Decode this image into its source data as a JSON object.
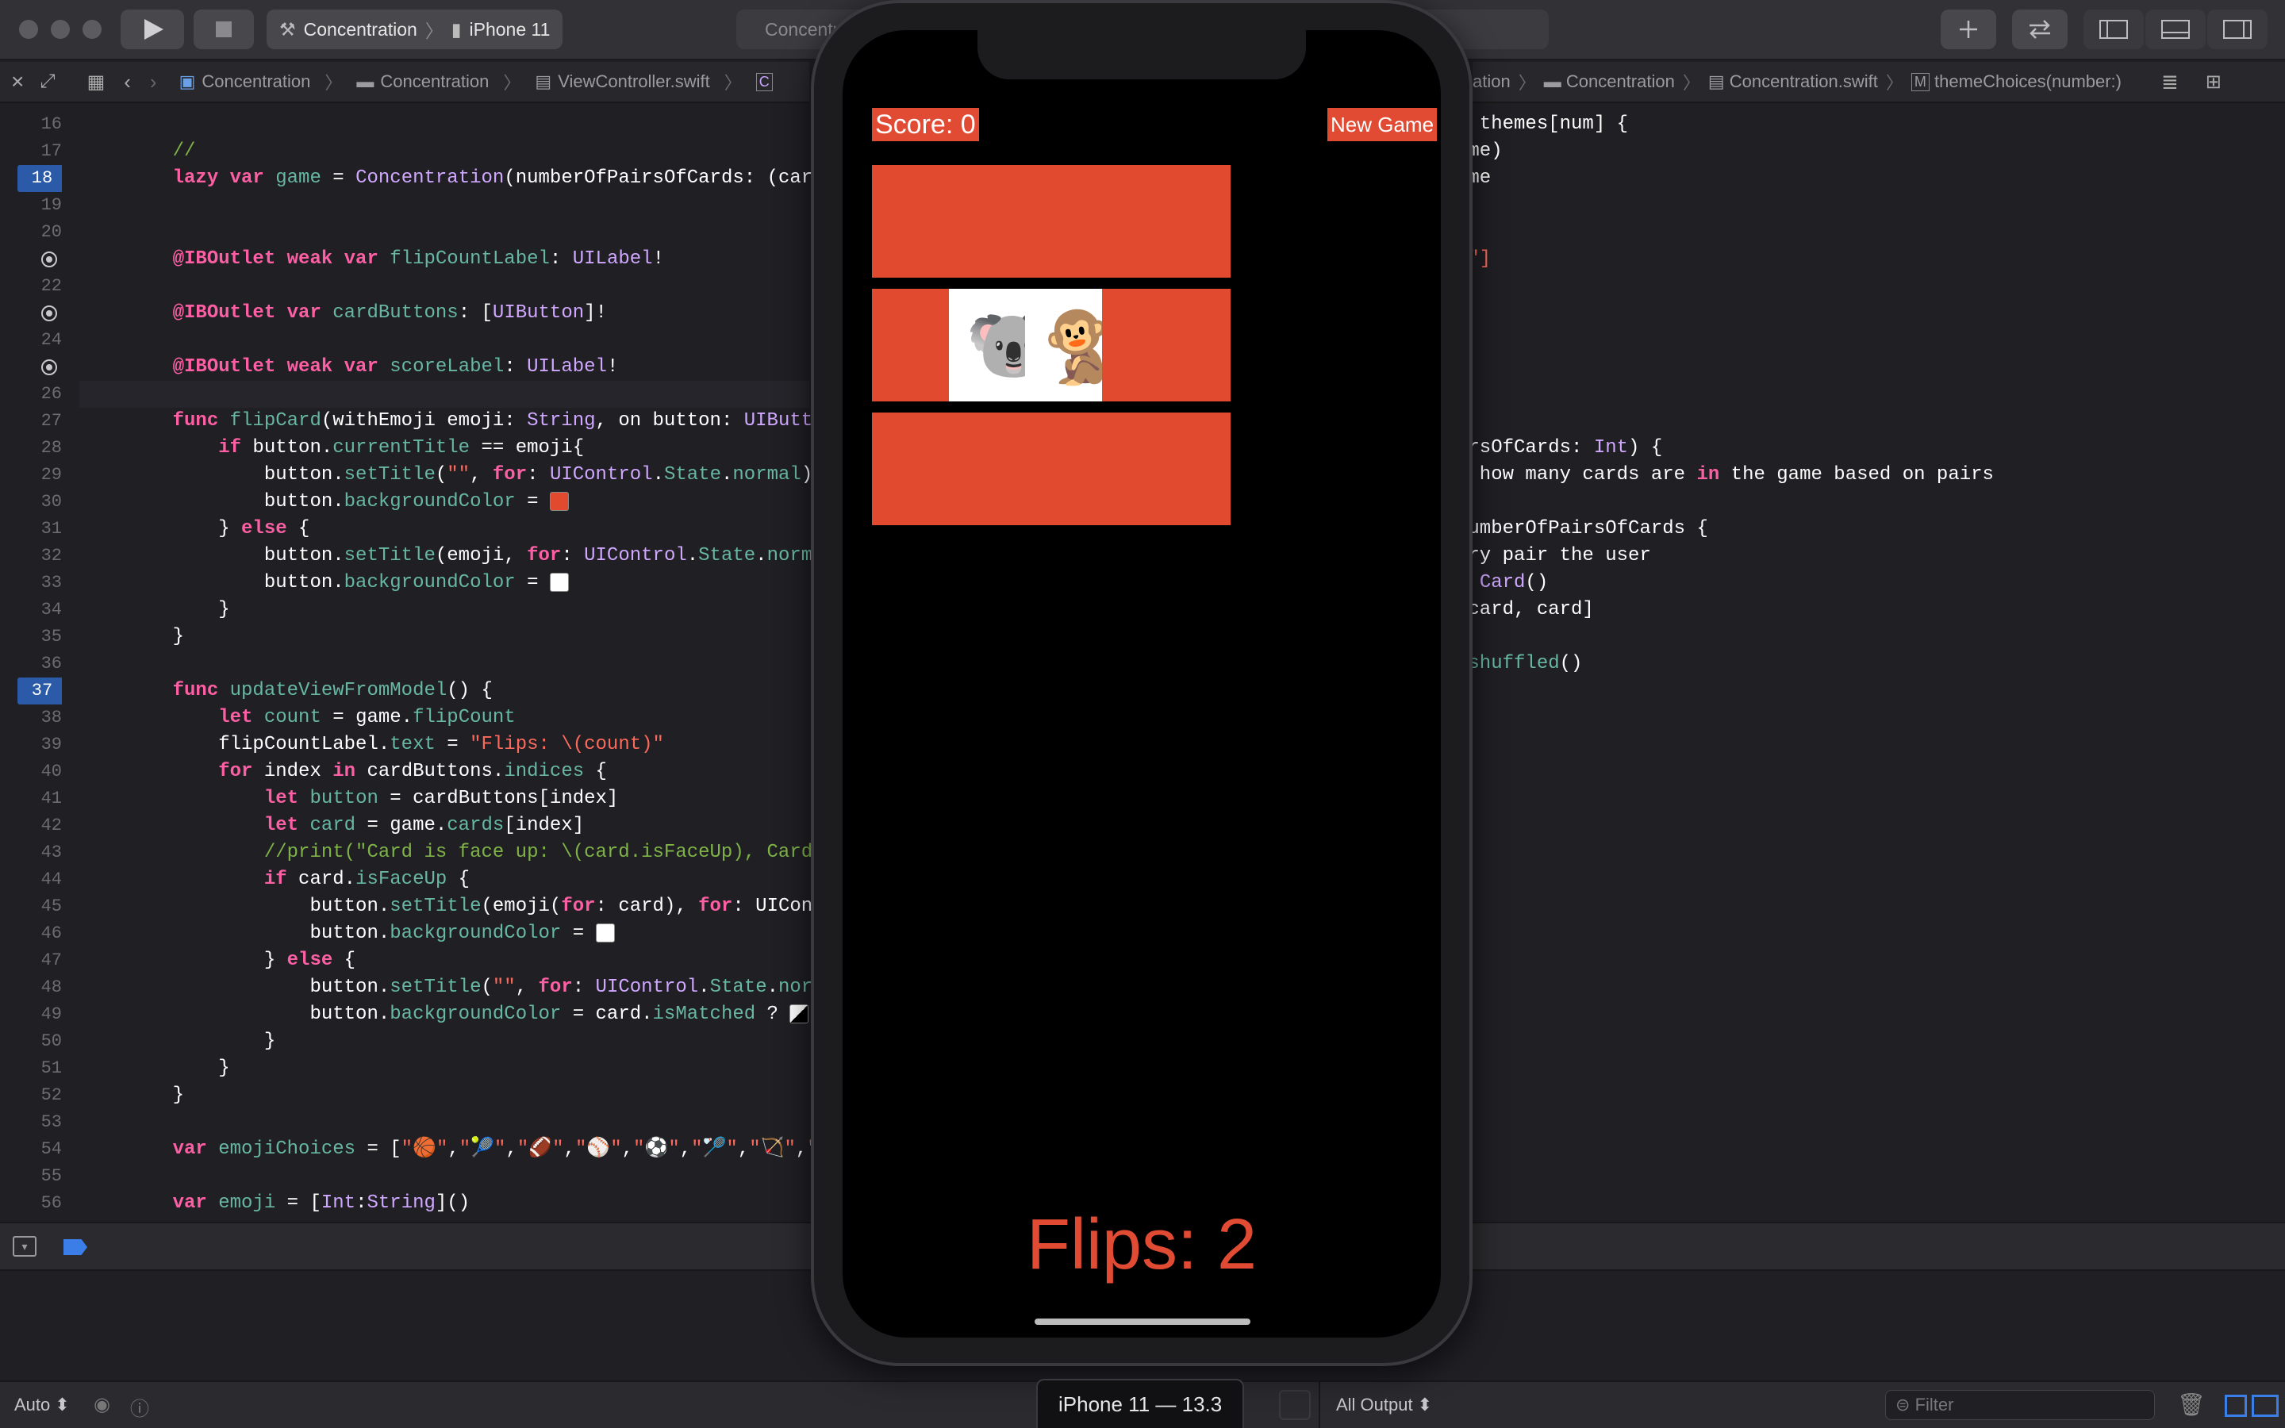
{
  "toolbar": {
    "scheme": "Concentration",
    "device": "iPhone 11",
    "activity": "Concentra"
  },
  "jumpbar_left": [
    "Concentration",
    "Concentration",
    "ViewController.swift"
  ],
  "jumpbar_right": [
    "ation",
    "Concentration",
    "Concentration.swift",
    "themeChoices(number:)"
  ],
  "editor_left": {
    "line_numbers": [
      "16",
      "17",
      "18",
      "19",
      "20",
      "21",
      "22",
      "23",
      "24",
      "25",
      "26",
      "27",
      "28",
      "29",
      "30",
      "31",
      "32",
      "33",
      "34",
      "35",
      "36",
      "37",
      "38",
      "39",
      "40",
      "41",
      "42",
      "43",
      "44",
      "45",
      "46",
      "47",
      "48",
      "49",
      "50",
      "51",
      "52",
      "53",
      "54",
      "55",
      "56"
    ],
    "breakpoint_lines": [
      "18",
      "37"
    ],
    "outlet_lines": [
      "21",
      "23",
      "25"
    ],
    "lines": [
      "",
      "    //",
      "    lazy var game = Concentration(numberOfPairsOfCards: (cardB",
      "",
      "",
      "    @IBOutlet weak var flipCountLabel: UILabel!",
      "",
      "    @IBOutlet var cardButtons: [UIButton]!",
      "",
      "    @IBOutlet weak var scoreLabel: UILabel!",
      "",
      "    func flipCard(withEmoji emoji: String, on button: UIButton",
      "        if button.currentTitle == emoji{",
      "            button.setTitle(\"\", for: UIControl.State.normal)",
      "            button.backgroundColor = ",
      "        } else {",
      "            button.setTitle(emoji, for: UIControl.State.normal",
      "            button.backgroundColor = ",
      "        }",
      "    }",
      "",
      "    func updateViewFromModel() {",
      "        let count = game.flipCount",
      "        flipCountLabel.text = \"Flips: \\(count)\"",
      "        for index in cardButtons.indices {",
      "            let button = cardButtons[index]",
      "            let card = game.cards[index]",
      "            //print(\"Card is face up: \\(card.isFaceUp), Card i",
      "            if card.isFaceUp {",
      "                button.setTitle(emoji(for: card), for: UIContr",
      "                button.backgroundColor = ",
      "            } else {",
      "                button.setTitle(\"\", for: UIControl.State.norma",
      "                button.backgroundColor = card.isMatched ? ",
      "            }",
      "        }",
      "    }",
      "",
      "    var emojiChoices = [\"🏀\",\"🎾\",\"🏈\",\"⚾\",\"⚽\",\"🏸\",\"🏹\",\"🎱",
      "",
      "    var emoji = [Int:String]()"
    ]
  },
  "editor_right": {
    "lines": [
      {
        "row": 0,
        "text": "= themes[num] {"
      },
      {
        "row": 1,
        "text": "eme)"
      },
      {
        "row": 2,
        "text": "eme"
      },
      {
        "row": 5,
        "text": "?\"]"
      },
      {
        "row": 12,
        "text": "irsOfCards: Int) {"
      },
      {
        "row": 13,
        "text": "s how many cards are in the game based on pairs"
      },
      {
        "row": 15,
        "text": "numberOfPairsOfCards {"
      },
      {
        "row": 16,
        "text": "ery pair the user"
      },
      {
        "row": 17,
        "text": "= Card()"
      },
      {
        "row": 18,
        "text": "[card, card]"
      },
      {
        "row": 20,
        "text": ".shuffled()"
      }
    ]
  },
  "app": {
    "score": "Score: 0",
    "new_game": "New Game",
    "flips": "Flips: 2",
    "cards": [
      "",
      "",
      "",
      "",
      "",
      "🐨",
      "🐒",
      "",
      "",
      "",
      "",
      ""
    ],
    "card_color": "#e14a2f",
    "face_up_color": "#ffffff"
  },
  "simulator": {
    "device_label": "iPhone 11 — 13.3"
  },
  "bottom": {
    "auto": "Auto",
    "output": "All Output",
    "filter": "Filter"
  },
  "colors": {
    "accent": "#2a5aa8",
    "card": "#e14a2f",
    "keyword": "#fc5fa3",
    "string": "#fc6a5d",
    "comment": "#7fb347",
    "property": "#67b7a4"
  }
}
